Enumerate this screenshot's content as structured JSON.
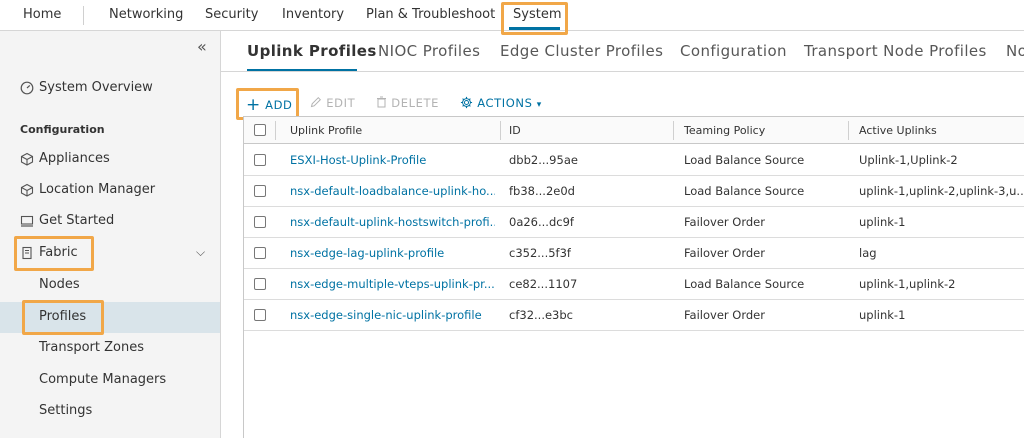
{
  "topnav": {
    "items": [
      "Home",
      "Networking",
      "Security",
      "Inventory",
      "Plan & Troubleshoot",
      "System"
    ],
    "active": "System"
  },
  "sidebar": {
    "system_overview": "System Overview",
    "heading": "Configuration",
    "items": [
      "Appliances",
      "Location Manager",
      "Get Started",
      "Fabric"
    ],
    "fabric_children": [
      "Nodes",
      "Profiles",
      "Transport Zones",
      "Compute Managers",
      "Settings"
    ],
    "selected": "Profiles"
  },
  "tabs": [
    "Uplink Profiles",
    "NIOC Profiles",
    "Edge Cluster Profiles",
    "Configuration",
    "Transport Node Profiles",
    "No"
  ],
  "toolbar": {
    "add": "ADD",
    "edit": "EDIT",
    "delete": "DELETE",
    "actions": "ACTIONS"
  },
  "table": {
    "columns": [
      "Uplink Profile",
      "ID",
      "Teaming Policy",
      "Active Uplinks"
    ],
    "rows": [
      [
        "ESXI-Host-Uplink-Profile",
        "dbb2...95ae",
        "Load Balance Source",
        "Uplink-1,Uplink-2"
      ],
      [
        "nsx-default-loadbalance-uplink-ho...",
        "fb38...2e0d",
        "Load Balance Source",
        "uplink-1,uplink-2,uplink-3,u..."
      ],
      [
        "nsx-default-uplink-hostswitch-profi...",
        "0a26...dc9f",
        "Failover Order",
        "uplink-1"
      ],
      [
        "nsx-edge-lag-uplink-profile",
        "c352...5f3f",
        "Failover Order",
        "lag"
      ],
      [
        "nsx-edge-multiple-vteps-uplink-pr...",
        "ce82...1107",
        "Load Balance Source",
        "uplink-1,uplink-2"
      ],
      [
        "nsx-edge-single-nic-uplink-profile",
        "cf32...e3bc",
        "Failover Order",
        "uplink-1"
      ]
    ]
  },
  "colors": {
    "accent": "#0072a3",
    "highlight": "#f1a748",
    "selected_bg": "#d9e4ea"
  }
}
